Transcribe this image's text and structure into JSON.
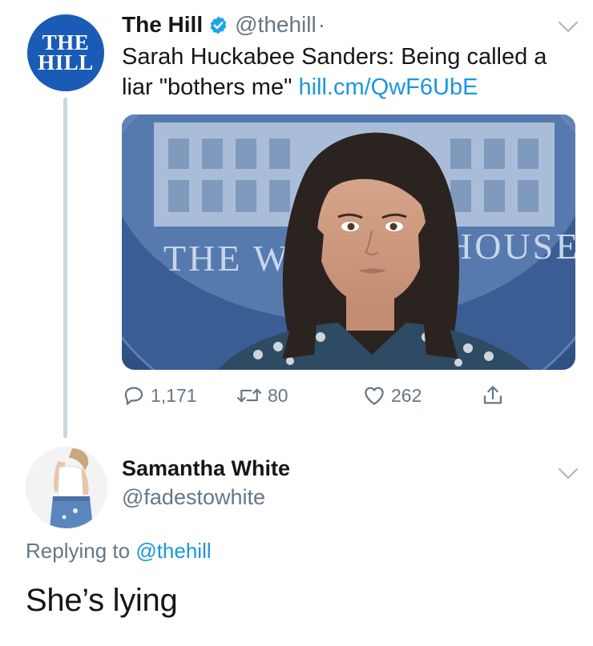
{
  "tweet": {
    "avatar_line1": "THE",
    "avatar_line2": "HILL",
    "display_name": "The Hill",
    "handle": "@thehill",
    "separator": "·",
    "text": "Sarah Huckabee Sanders: Being called a liar \"bothers me\"",
    "link": "hill.cm/QwF6UbE",
    "media": {
      "sign_left": "THE W",
      "sign_right": "HOUSE"
    },
    "stats": {
      "replies": "1,171",
      "retweets": "80",
      "likes": "262"
    },
    "icons": {
      "verified": "verified-badge-icon",
      "menu": "chevron-down-icon",
      "reply": "reply-icon",
      "retweet": "retweet-icon",
      "like": "heart-icon",
      "share": "share-icon"
    }
  },
  "reply": {
    "display_name": "Samantha White",
    "handle": "@fadestowhite",
    "replying_prefix": "Replying to",
    "replying_mention": "@thehill",
    "text": "She’s lying"
  },
  "colors": {
    "link": "#1b95e0",
    "secondary_text": "#657786",
    "primary_text": "#14171a",
    "hill_blue": "#1a5bb5",
    "verified": "#1da1f2"
  }
}
